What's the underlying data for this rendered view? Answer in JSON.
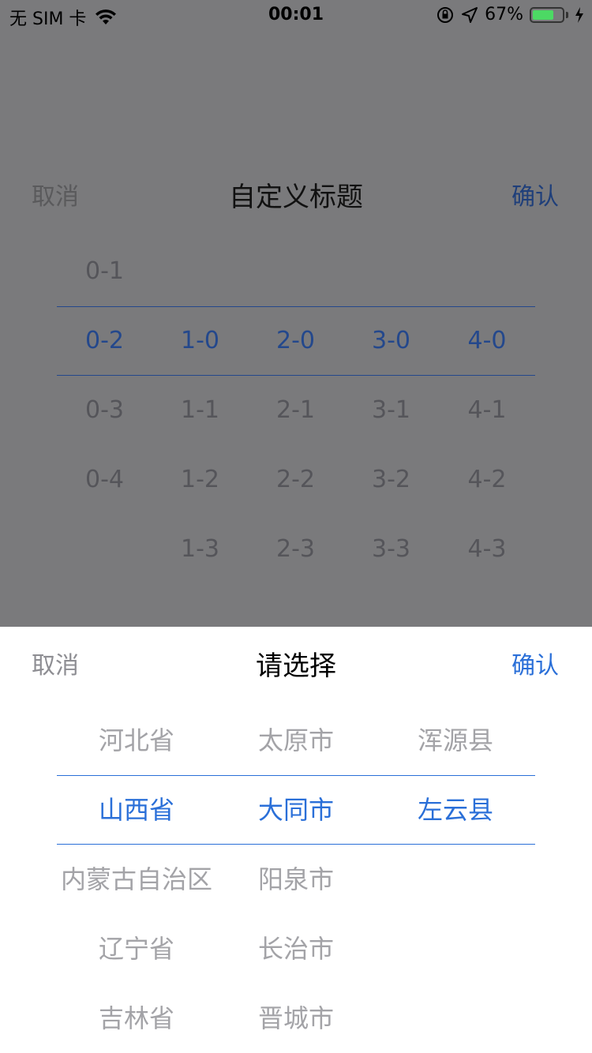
{
  "status_bar": {
    "carrier": "无 SIM 卡",
    "time": "00:01",
    "battery_percent": "67%",
    "battery_level": 0.67,
    "icons": [
      "wifi-icon",
      "orientation-lock-icon",
      "location-arrow-icon",
      "battery-icon",
      "charging-bolt-icon"
    ]
  },
  "colors": {
    "overlay": "#7a7a7c",
    "accent": "#2a6fd8",
    "dim_accent": "#24488c",
    "unselected_text": "#a3a3a7"
  },
  "custom_picker": {
    "cancel_label": "取消",
    "title": "自定义标题",
    "confirm_label": "确认",
    "columns": [
      [
        "0-1",
        "0-2",
        "0-3",
        "0-4"
      ],
      [
        "1-0",
        "1-1",
        "1-2",
        "1-3"
      ],
      [
        "2-0",
        "2-1",
        "2-2",
        "2-3"
      ],
      [
        "3-0",
        "3-1",
        "3-2",
        "3-3"
      ],
      [
        "4-0",
        "4-1",
        "4-2",
        "4-3"
      ]
    ],
    "selected": [
      "0-2",
      "1-0",
      "2-0",
      "3-0",
      "4-0"
    ]
  },
  "region_picker": {
    "cancel_label": "取消",
    "title": "请选择",
    "confirm_label": "确认",
    "province_col": [
      "河北省",
      "山西省",
      "内蒙古自治区",
      "辽宁省",
      "吉林省"
    ],
    "city_col": [
      "太原市",
      "大同市",
      "阳泉市",
      "长治市",
      "晋城市"
    ],
    "county_col": [
      "浑源县",
      "左云县"
    ],
    "selected": {
      "province": "山西省",
      "city": "大同市",
      "county": "左云县"
    }
  }
}
